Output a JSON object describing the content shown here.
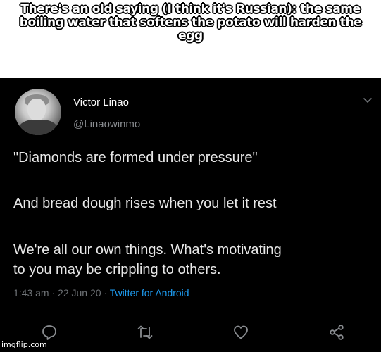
{
  "caption": {
    "line1": "There's an old saying (I think it's Russian): the same",
    "line2": "boiling water that softens the potato will harden the",
    "line3": "egg"
  },
  "tweet": {
    "author_name": "Victor Linao",
    "author_handle": "@Linaowinmo",
    "lines": [
      "\"Diamonds are formed under pressure\"",
      "And bread dough rises when you let it rest",
      "We're all our own things. What's motivating",
      "to you may be crippling to others."
    ],
    "time": "1:43 am",
    "date": "22 Jun 20",
    "separator": "·",
    "source": "Twitter for Android"
  },
  "icons": {
    "reply": "reply-icon",
    "retweet": "retweet-icon",
    "like": "heart-icon",
    "share": "share-icon",
    "menu": "chevron-down-icon"
  },
  "colors": {
    "tweet_background": "#000000",
    "link": "#1d9bf0",
    "meta_gray": "#6f7377"
  },
  "watermark": "imgflip.com"
}
